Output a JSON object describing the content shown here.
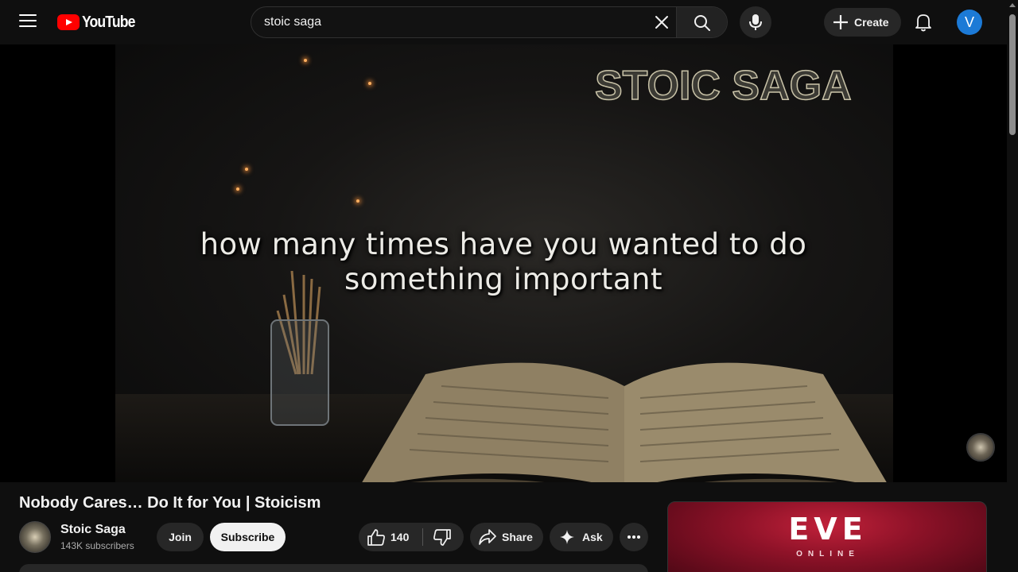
{
  "header": {
    "logo_text": "YouTube",
    "search_value": "stoic saga",
    "create_label": "Create",
    "avatar_letter": "V"
  },
  "player": {
    "overlay_title": "STOIC SAGA",
    "subtitle_line1": "how many times have you wanted to do",
    "subtitle_line2": "something important"
  },
  "video": {
    "title": "Nobody Cares… Do It for You | Stoicism",
    "channel_name": "Stoic Saga",
    "subscribers": "143K subscribers",
    "join_label": "Join",
    "subscribe_label": "Subscribe",
    "like_count": "140",
    "share_label": "Share",
    "ask_label": "Ask"
  },
  "ad": {
    "logo": "EVE",
    "sub": "ONLINE"
  },
  "colors": {
    "brand_red": "#ff0000",
    "background": "#0f0f0f",
    "chip": "#272727",
    "avatar_blue": "#1c7ad6"
  },
  "icons": [
    "menu-icon",
    "youtube-logo-icon",
    "close-icon",
    "search-icon",
    "mic-icon",
    "plus-icon",
    "bell-icon",
    "thumbs-up-icon",
    "thumbs-down-icon",
    "share-icon",
    "sparkle-icon",
    "more-icon"
  ]
}
